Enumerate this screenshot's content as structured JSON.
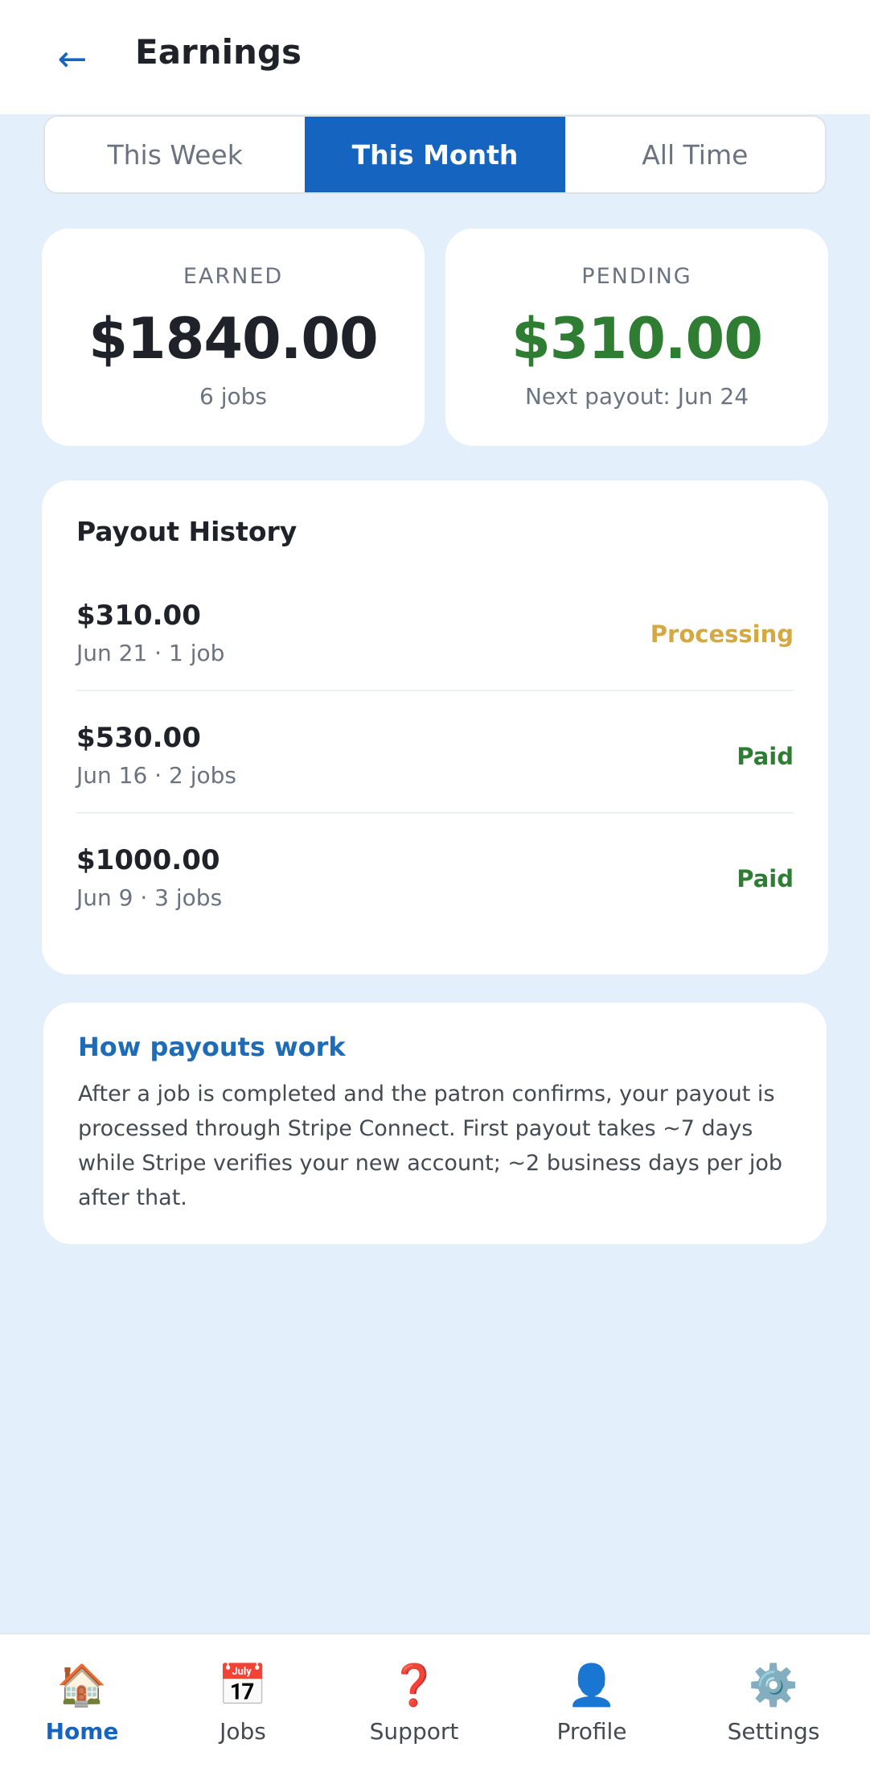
{
  "header": {
    "back_icon": "←",
    "title": "Earnings"
  },
  "tabs": [
    {
      "label": "This Week",
      "active": false
    },
    {
      "label": "This Month",
      "active": true
    },
    {
      "label": "All Time",
      "active": false
    }
  ],
  "summary": {
    "earned": {
      "label": "EARNED",
      "value": "$1840.00",
      "sub": "6 jobs"
    },
    "pending": {
      "label": "PENDING",
      "value": "$310.00",
      "sub": "Next payout: Jun 24"
    }
  },
  "history": {
    "title": "Payout History",
    "rows": [
      {
        "amount": "$310.00",
        "meta": "Jun 21 · 1 job",
        "status": "Processing"
      },
      {
        "amount": "$530.00",
        "meta": "Jun 16 · 2 jobs",
        "status": "Paid"
      },
      {
        "amount": "$1000.00",
        "meta": "Jun 9 · 3 jobs",
        "status": "Paid"
      }
    ]
  },
  "info": {
    "title": "How payouts work",
    "body": "After a job is completed and the patron confirms, your payout is processed through Stripe Connect. First payout takes ~7 days while Stripe verifies your new account; ~2 business days per job after that."
  },
  "nav": [
    {
      "icon": "🏠",
      "icon_name": "home-icon",
      "label": "Home",
      "active": true
    },
    {
      "icon": "📅",
      "icon_name": "calendar-icon",
      "label": "Jobs",
      "active": false
    },
    {
      "icon": "❓",
      "icon_name": "question-icon",
      "label": "Support",
      "active": false
    },
    {
      "icon": "👤",
      "icon_name": "profile-icon",
      "label": "Profile",
      "active": false
    },
    {
      "icon": "⚙️",
      "icon_name": "gear-icon",
      "label": "Settings",
      "active": false
    }
  ],
  "colors": {
    "accent": "#1565c0",
    "background": "#e3effb",
    "paid": "#2e7d32",
    "processing": "#d4a843"
  }
}
